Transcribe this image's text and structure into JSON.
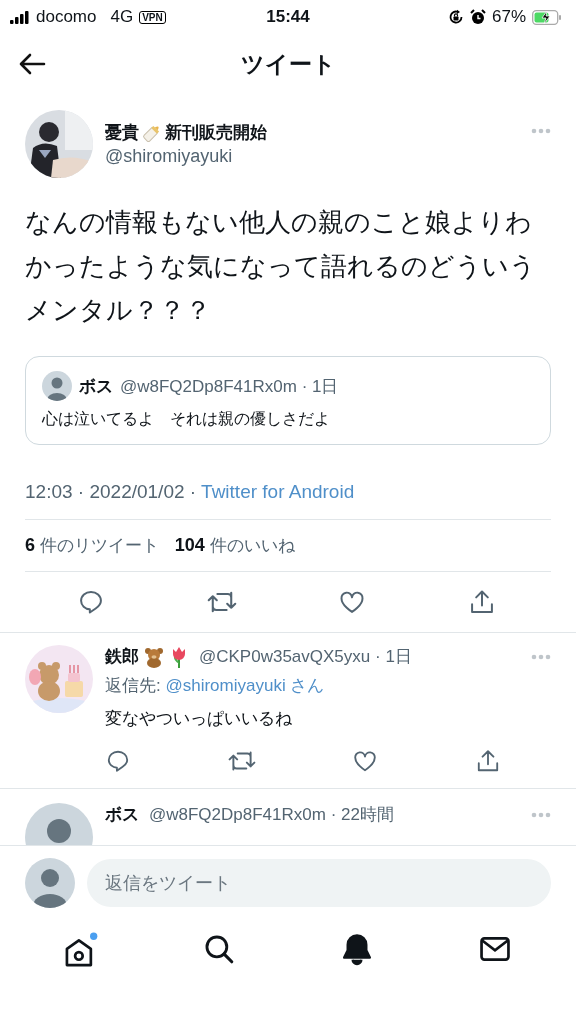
{
  "status_bar": {
    "carrier": "docomo",
    "network": "4G",
    "vpn": "VPN",
    "time": "15:44",
    "battery": "67%",
    "charging": true
  },
  "header": {
    "title": "ツイート"
  },
  "tweet": {
    "name": "憂貴",
    "name_suffix": "新刊販売開始",
    "handle": "@shiromiyayuki",
    "text": "なんの情報もない他人の親のこと娘よりわかったような気になって語れるのどういうメンタル？？？",
    "quote": {
      "name": "ボス",
      "handle": "@w8FQ2Dp8F41Rx0m",
      "age": "· 1日",
      "text": "心は泣いてるよ　それは親の優しさだよ"
    },
    "time": "12:03 · 2022/01/02 · ",
    "source": "Twitter for Android",
    "stats": [
      {
        "count": "6",
        "label": "件のリツイート"
      },
      {
        "count": "104",
        "label": "件のいいね"
      }
    ]
  },
  "replies": [
    {
      "name": "鉄郎",
      "handle": "@CKP0w35avQX5yxu",
      "age": "· 1日",
      "kind": "picture",
      "reply_to_label": "返信先: ",
      "reply_to": "@shiromiyayuki さん",
      "text": "変なやついっぱいいるね"
    },
    {
      "name": "ボス",
      "handle": "@w8FQ2Dp8F41Rx0m",
      "age": "· 22時間",
      "kind": "default"
    }
  ],
  "composer": {
    "placeholder": "返信をツイート"
  },
  "tabs": [
    {
      "kind": "home",
      "selected": false,
      "dot": true
    },
    {
      "kind": "search",
      "selected": false,
      "dot": false
    },
    {
      "kind": "bell",
      "selected": true,
      "dot": false
    },
    {
      "kind": "mail",
      "selected": false,
      "dot": false
    }
  ]
}
